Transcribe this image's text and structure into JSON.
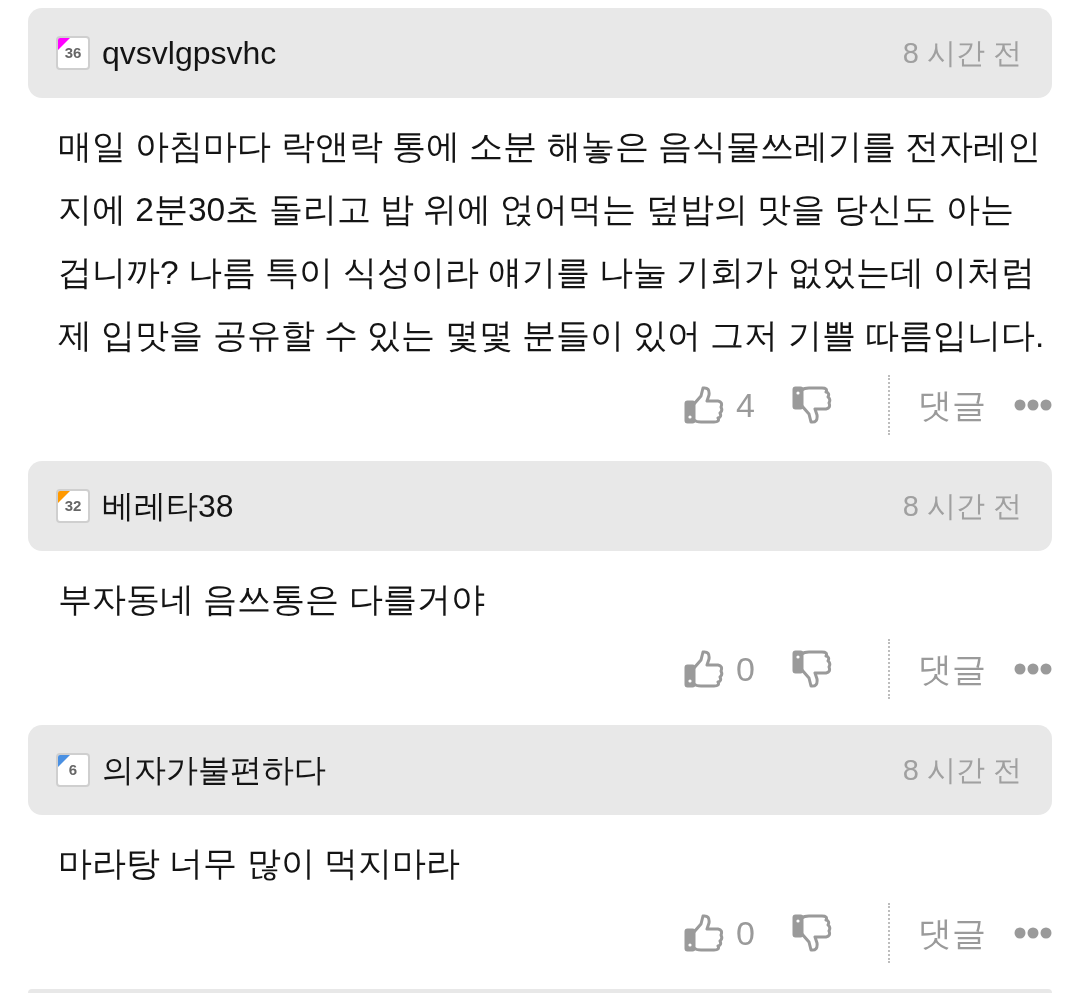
{
  "comments": [
    {
      "author": {
        "name": "qvsvlgpsvhc",
        "level": "36",
        "color": "#ff00ff"
      },
      "time": "8 시간 전",
      "text": "매일 아침마다 락앤락 통에 소분 해놓은 음식물쓰레기를 전자레인지에 2분30초 돌리고 밥 위에 얹어먹는 덮밥의 맛을 당신도 아는 겁니까? 나름 특이 식성이라 얘기를 나눌 기회가 없었는데 이처럼 제 입맛을 공유할 수 있는 몇몇 분들이 있어 그저 기쁠 따름입니다.",
      "likes": "4",
      "reply": "댓글"
    },
    {
      "author": {
        "name": "베레타38",
        "level": "32",
        "color": "#ff9900"
      },
      "time": "8 시간 전",
      "text": "부자동네 음쓰통은 다를거야",
      "likes": "0",
      "reply": "댓글"
    },
    {
      "author": {
        "name": "의자가불편하다",
        "level": "6",
        "color": "#4a90e2"
      },
      "time": "8 시간 전",
      "text": "마라탕 너무 많이 먹지마라",
      "likes": "0",
      "reply": "댓글"
    }
  ]
}
